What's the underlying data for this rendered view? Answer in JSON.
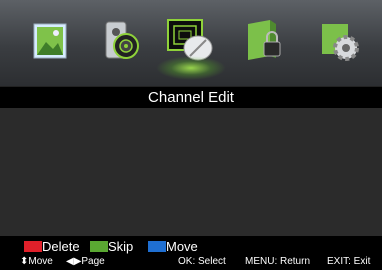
{
  "menu": {
    "items": [
      {
        "icon": "picture-icon"
      },
      {
        "icon": "sound-icon"
      },
      {
        "icon": "channel-icon",
        "active": true
      },
      {
        "icon": "lock-icon"
      },
      {
        "icon": "setup-gear-icon"
      }
    ]
  },
  "title": "Channel Edit",
  "legend": {
    "delete": {
      "label": "Delete",
      "color": "#e0202a"
    },
    "skip": {
      "label": "Skip",
      "color": "#5aa832"
    },
    "move": {
      "label": "Move",
      "color": "#1f6fd1"
    }
  },
  "help": {
    "move": "Move",
    "page": "Page",
    "ok": "OK: Select",
    "menu": "MENU: Return",
    "exit": "EXIT: Exit"
  }
}
